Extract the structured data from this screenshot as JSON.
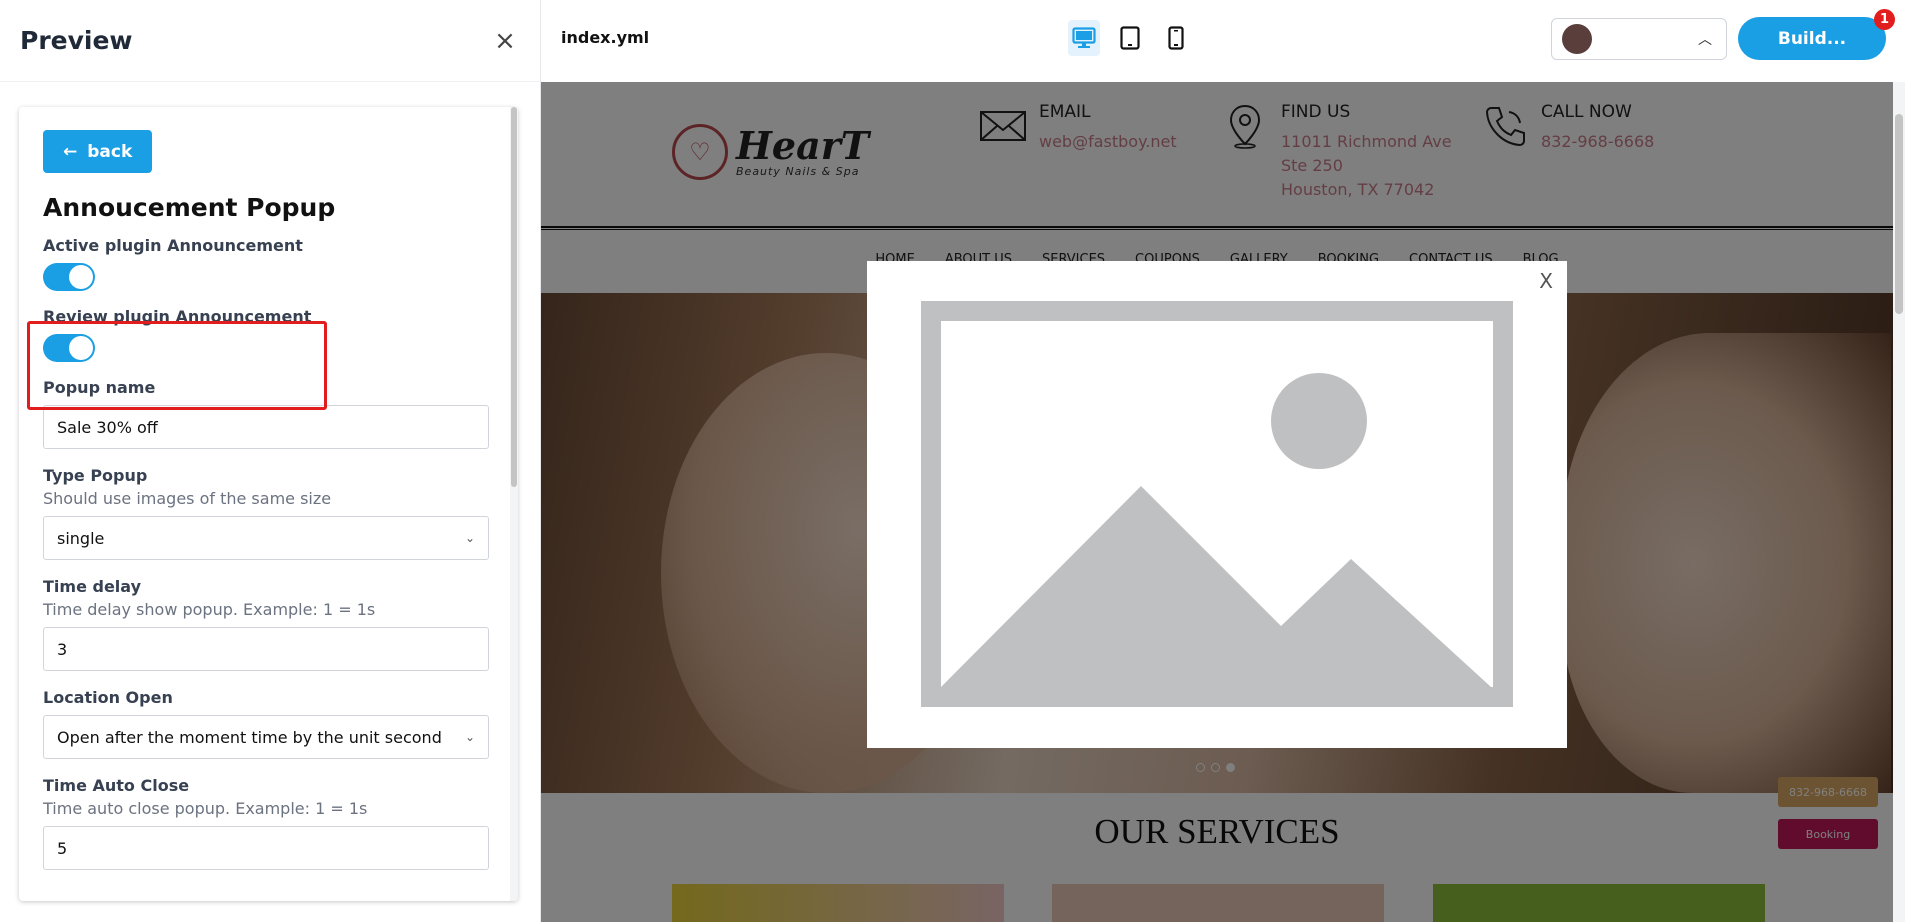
{
  "panel": {
    "title": "Preview",
    "back_label": "back",
    "section_title": "Annoucement Popup",
    "active_label": "Active plugin Announcement",
    "review_label": "Review plugin Announcement",
    "popup_name_label": "Popup name",
    "popup_name_value": "Sale 30% off",
    "type_label": "Type Popup",
    "type_hint": "Should use images of the same size",
    "type_value": "single",
    "delay_label": "Time delay",
    "delay_hint": "Time delay show popup. Example: 1 = 1s",
    "delay_value": "3",
    "location_label": "Location Open",
    "location_value": "Open after the moment time by the unit second",
    "autoclose_label": "Time Auto Close",
    "autoclose_hint": "Time auto close popup. Example: 1 = 1s",
    "autoclose_value": "5"
  },
  "topbar": {
    "filename": "index.yml",
    "build_label": "Build...",
    "badge_count": "1"
  },
  "site": {
    "logo_title": "HearT",
    "logo_sub": "Beauty Nails & Spa",
    "email_title": "EMAIL",
    "email_value": "web@fastboy.net",
    "find_title": "FIND US",
    "find_line1": "11011 Richmond Ave",
    "find_line2": "Ste 250",
    "find_line3": "Houston, TX 77042",
    "call_title": "CALL NOW",
    "call_value": "832-968-6668",
    "nav": [
      "HOME",
      "ABOUT US",
      "SERVICES",
      "COUPONS",
      "GALLERY",
      "BOOKING",
      "CONTACT US",
      "BLOG"
    ],
    "services_title": "OUR SERVICES",
    "float_phone": "832-968-6668",
    "float_booking": "Booking",
    "popup_close": "X"
  },
  "colors": {
    "accent": "#1a9ee4",
    "highlight": "#e11d1d",
    "link": "#c97d8a"
  }
}
